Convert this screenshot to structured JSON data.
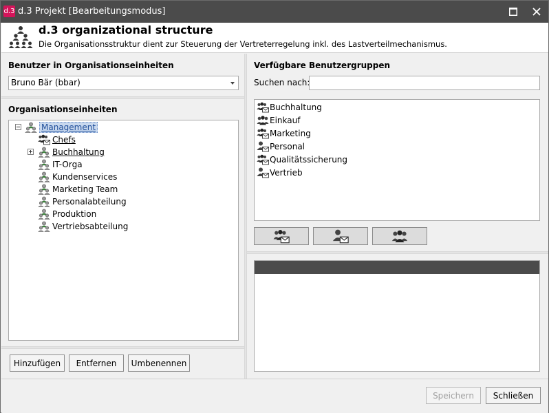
{
  "window": {
    "app_icon_text": "d.3",
    "title": "d.3 Projekt [Bearbeitungsmodus]"
  },
  "header": {
    "title": "d.3 organizational structure",
    "description": "Die Organisationsstruktur dient zur Steuerung der Vertreterregelung inkl. des Lastverteilmechanismus."
  },
  "left": {
    "users_label": "Benutzer in Organisationseinheiten",
    "selected_user": "Bruno Bär (bbar)",
    "units_label": "Organisationseinheiten",
    "tree": [
      {
        "label": "Management",
        "level": 0,
        "expander": "minus",
        "icon": "org-unit-icon",
        "selected": true
      },
      {
        "label": "Chefs",
        "level": 1,
        "expander": "",
        "icon": "group-mail-icon",
        "underlined": true
      },
      {
        "label": "Buchhaltung",
        "level": 1,
        "expander": "plus",
        "icon": "org-unit-icon",
        "underlined": true
      },
      {
        "label": "IT-Orga",
        "level": 1,
        "expander": "",
        "icon": "org-unit-icon"
      },
      {
        "label": "Kundenservices",
        "level": 1,
        "expander": "",
        "icon": "org-unit-icon"
      },
      {
        "label": "Marketing Team",
        "level": 1,
        "expander": "",
        "icon": "org-unit-icon"
      },
      {
        "label": "Personalabteilung",
        "level": 1,
        "expander": "",
        "icon": "org-unit-icon"
      },
      {
        "label": "Produktion",
        "level": 1,
        "expander": "",
        "icon": "org-unit-icon"
      },
      {
        "label": "Vertriebsabteilung",
        "level": 1,
        "expander": "",
        "icon": "org-unit-icon"
      }
    ],
    "buttons": {
      "add": "Hinzufügen",
      "remove": "Entfernen",
      "rename": "Umbenennen"
    }
  },
  "right": {
    "groups_label": "Verfügbare Benutzergruppen",
    "search_label": "Suchen nach:",
    "search_value": "",
    "groups": [
      {
        "label": "Buchhaltung",
        "icon": "group-mail-icon"
      },
      {
        "label": "Einkauf",
        "icon": "group-icon"
      },
      {
        "label": "Marketing",
        "icon": "group-mail-icon"
      },
      {
        "label": "Personal",
        "icon": "user-mail-icon"
      },
      {
        "label": "Qualitätssicherung",
        "icon": "group-mail-icon"
      },
      {
        "label": "Vertrieb",
        "icon": "user-mail-icon"
      }
    ],
    "icon_buttons": [
      "group-mail-icon",
      "user-mail-icon",
      "group-icon"
    ]
  },
  "footer": {
    "save": "Speichern",
    "close": "Schließen"
  },
  "colors": {
    "titlebar": "#4b4b4b",
    "app_icon": "#d4145a",
    "selection": "#c8d8ee"
  }
}
